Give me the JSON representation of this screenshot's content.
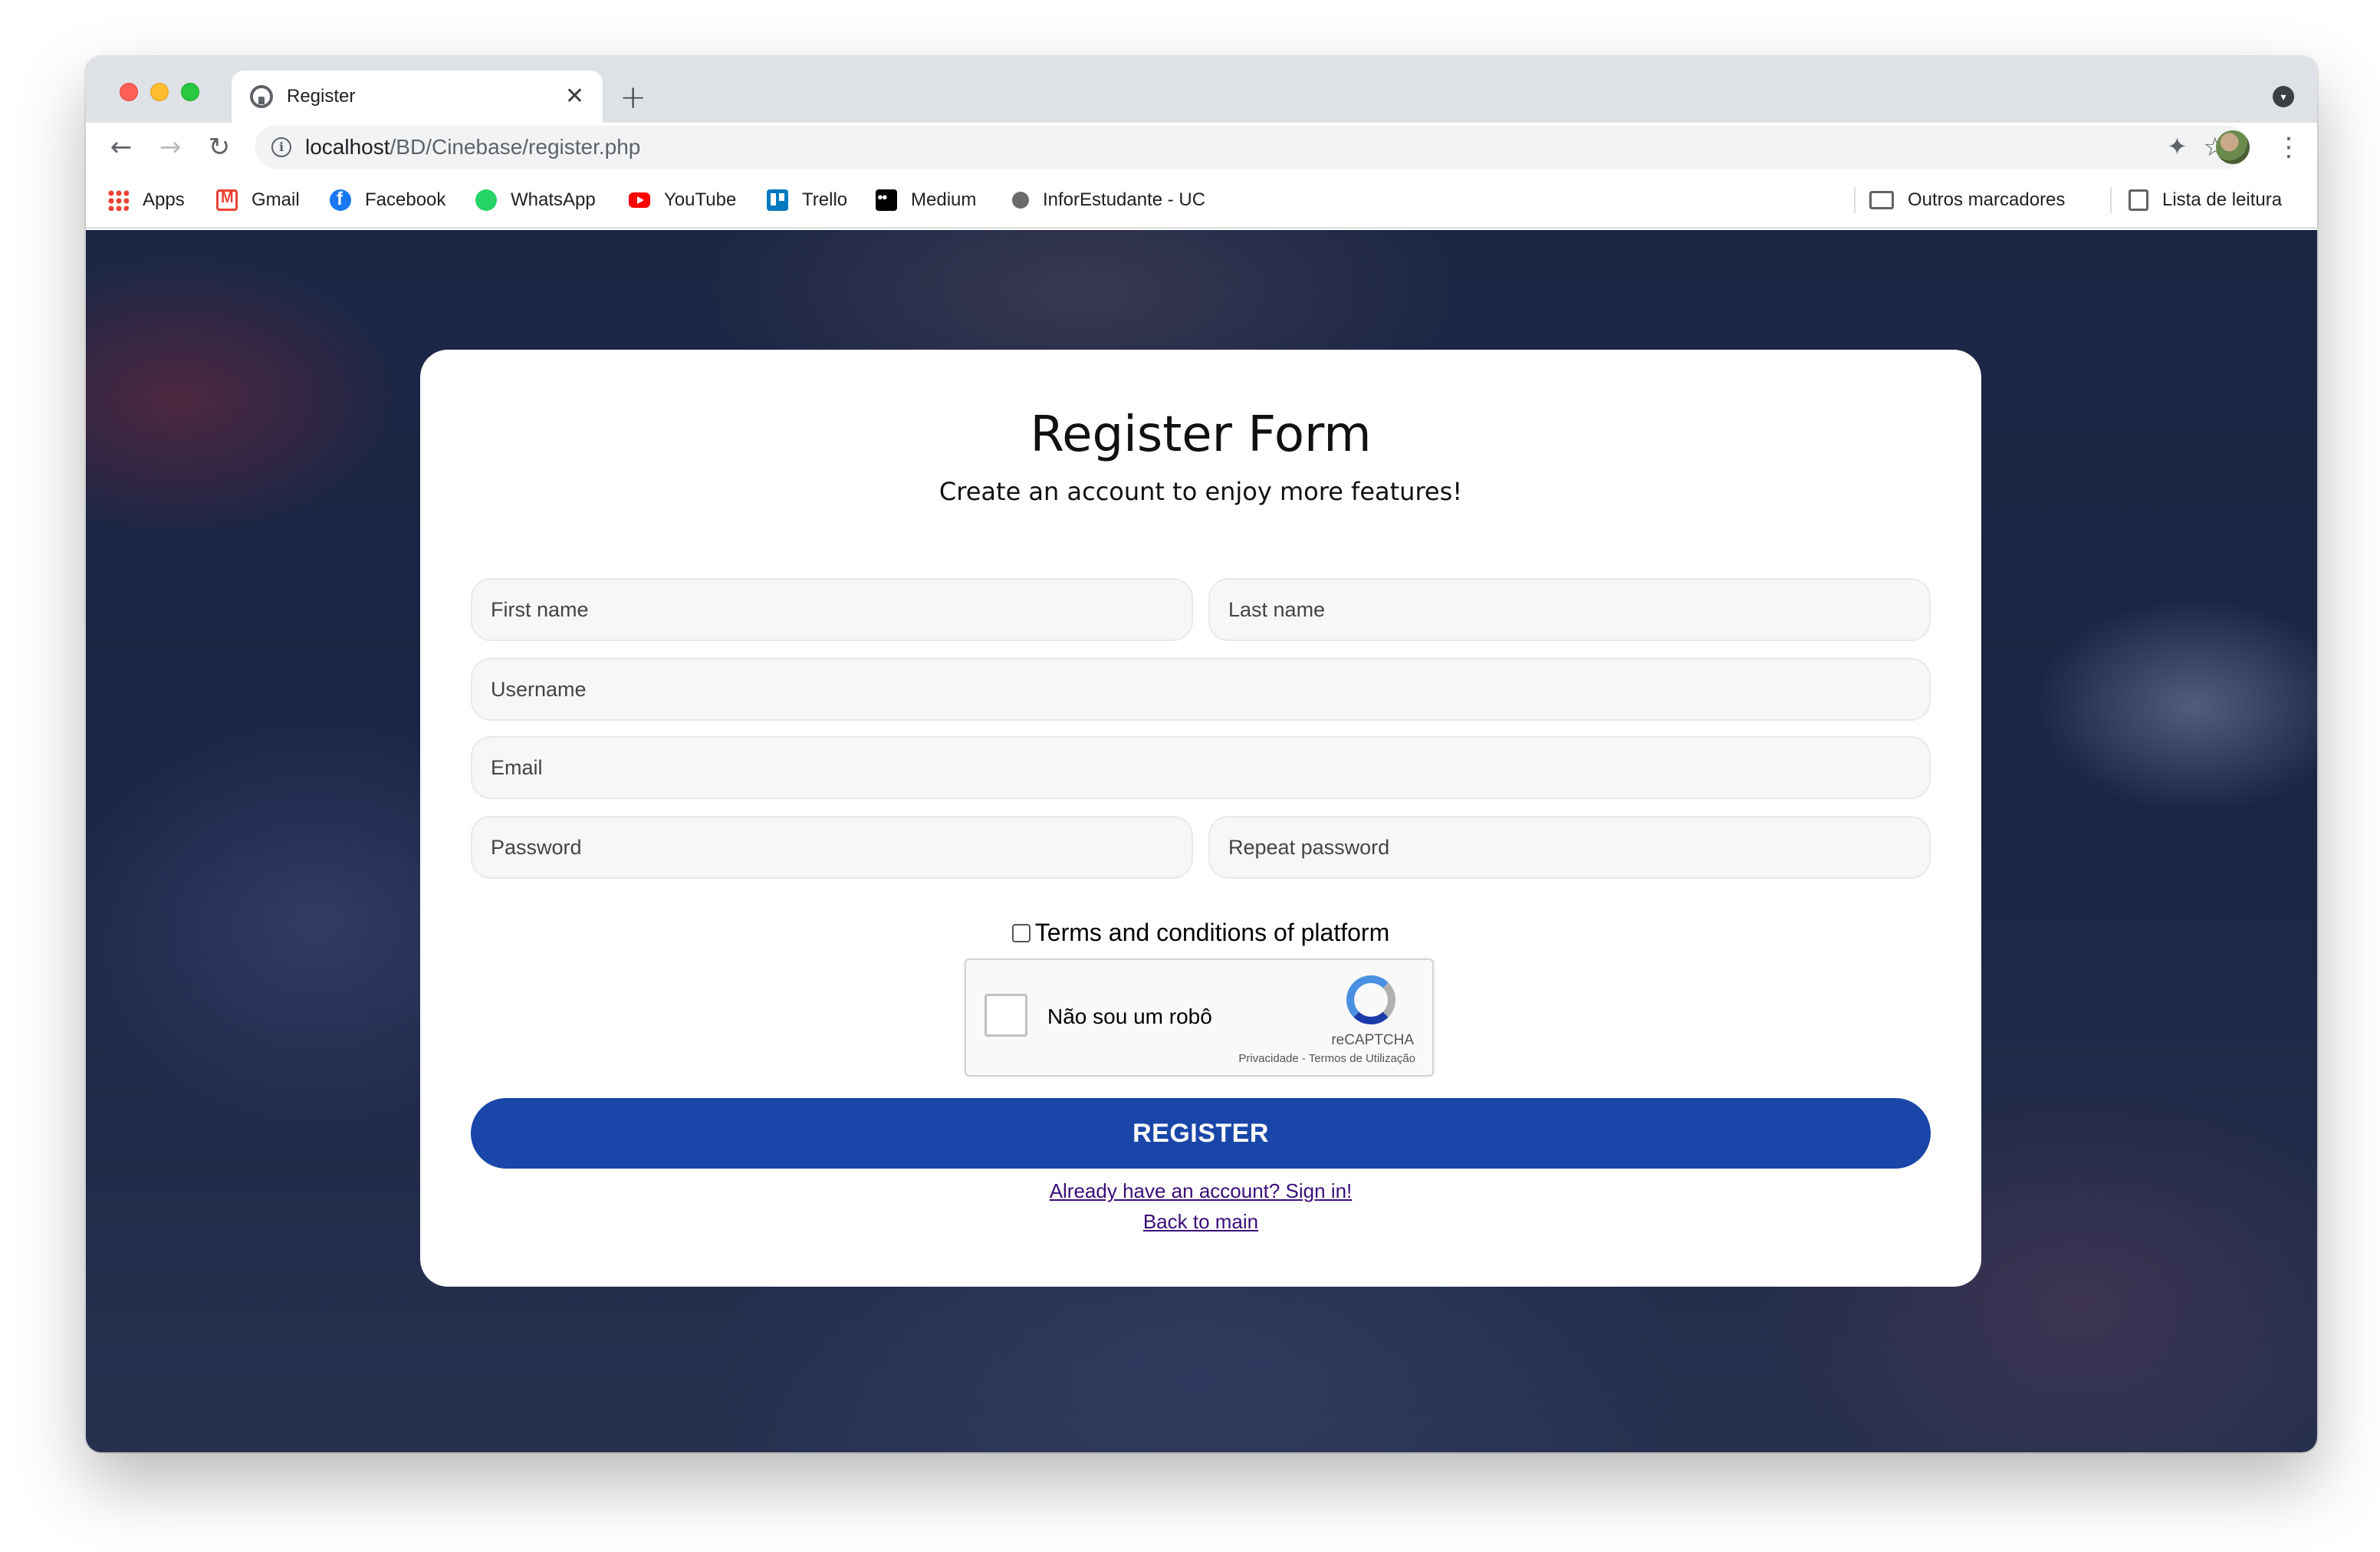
{
  "browser": {
    "tab_title": "Register",
    "tab_close": "✕",
    "new_tab": "+",
    "url_host": "localhost",
    "url_path": "/BD/Cinebase/register.php",
    "nav_back": "←",
    "nav_forward": "→",
    "nav_reload": "↻",
    "star": "☆",
    "menu": "⋮",
    "extensions": "✦",
    "profile_menu": "▾"
  },
  "bookmarks": [
    {
      "label": "Apps",
      "icon": "apps-grid-icon"
    },
    {
      "label": "Gmail",
      "icon": "gmail-icon"
    },
    {
      "label": "Facebook",
      "icon": "facebook-icon"
    },
    {
      "label": "WhatsApp",
      "icon": "whatsapp-icon"
    },
    {
      "label": "YouTube",
      "icon": "youtube-icon"
    },
    {
      "label": "Trello",
      "icon": "trello-icon"
    },
    {
      "label": "Medium",
      "icon": "medium-icon"
    },
    {
      "label": "InforEstudante - UC",
      "icon": "uc-icon"
    }
  ],
  "bookmarks_right": {
    "other": "Outros marcadores",
    "reading_list": "Lista de leitura"
  },
  "form": {
    "title": "Register Form",
    "subtitle": "Create an account to enjoy more features!",
    "first_name_placeholder": "First name",
    "last_name_placeholder": "Last name",
    "username_placeholder": "Username",
    "email_placeholder": "Email",
    "password_placeholder": "Password",
    "repeat_password_placeholder": "Repeat password",
    "terms_label": "Terms and conditions of platform",
    "register_label": "REGISTER",
    "signin_link": "Already have an account? Sign in!",
    "back_link": "Back to main"
  },
  "captcha": {
    "label": "Não sou um robô",
    "brand": "reCAPTCHA",
    "terms": "Privacidade - Termos de Utilização"
  },
  "colors": {
    "primary_button": "#1946a8",
    "link": "#3a0e7a",
    "page_background": "#1c2746"
  }
}
